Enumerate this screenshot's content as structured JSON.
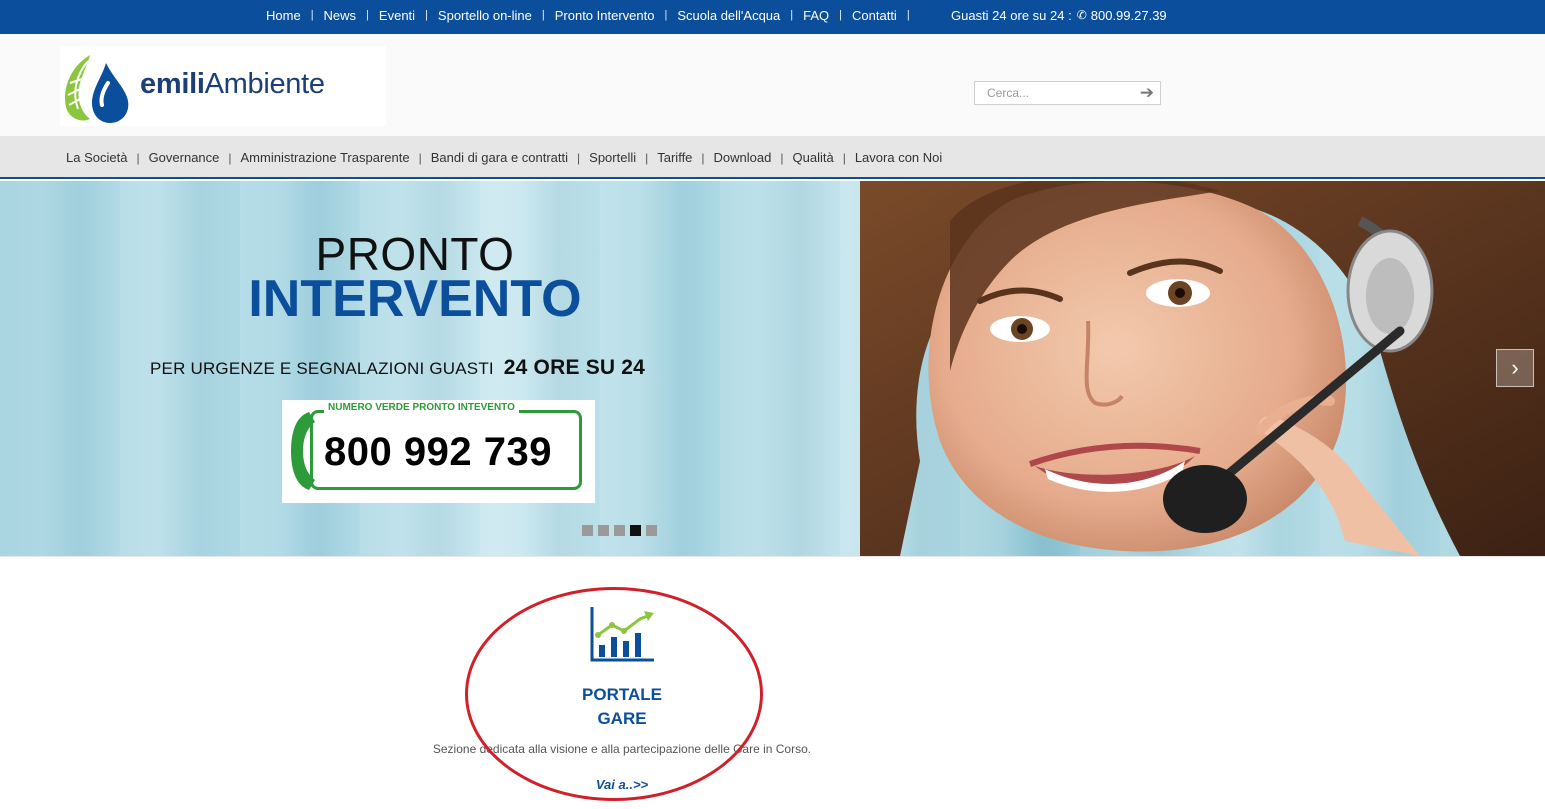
{
  "topbar": {
    "items": [
      "Home",
      "News",
      "Eventi",
      "Sportello on-line",
      "Pronto Intervento",
      "Scuola dell'Acqua",
      "FAQ",
      "Contatti"
    ],
    "separator": "|",
    "hotline_label": "Guasti 24 ore su 24 :",
    "hotline_number": "800.99.27.39",
    "phone_icon": "phone-icon"
  },
  "header": {
    "logo_text_bold": "emili",
    "logo_text_regular": "Ambiente",
    "search_placeholder": "Cerca...",
    "search_icon": "arrow-right-icon"
  },
  "mainnav": {
    "items": [
      "La Società",
      "Governance",
      "Amministrazione Trasparente",
      "Bandi di gara e contratti",
      "Sportelli",
      "Tariffe",
      "Download",
      "Qualità",
      "Lavora con Noi"
    ],
    "separator": "|"
  },
  "hero": {
    "title_line1": "PRONTO",
    "title_line2": "INTERVENTO",
    "subtitle": "PER URGENZE E SEGNALAZIONI GUASTI",
    "subtitle_strong": "24 ORE SU 24",
    "badge_label": "NUMERO VERDE PRONTO INTEVENTO",
    "badge_number": "800 992 739",
    "slides_total": 5,
    "active_slide": 4,
    "next_icon": "chevron-right-icon"
  },
  "portal": {
    "icon": "growth-chart-icon",
    "title_line1": "PORTALE",
    "title_line2": "GARE",
    "description": "Sezione dedicata alla visione e alla partecipazione delle Gare in Corso.",
    "link_label": "Vai a..>>"
  },
  "colors": {
    "brand_blue": "#0b4f9c",
    "green": "#2e9b3a",
    "annotation_red": "#d2202a"
  }
}
